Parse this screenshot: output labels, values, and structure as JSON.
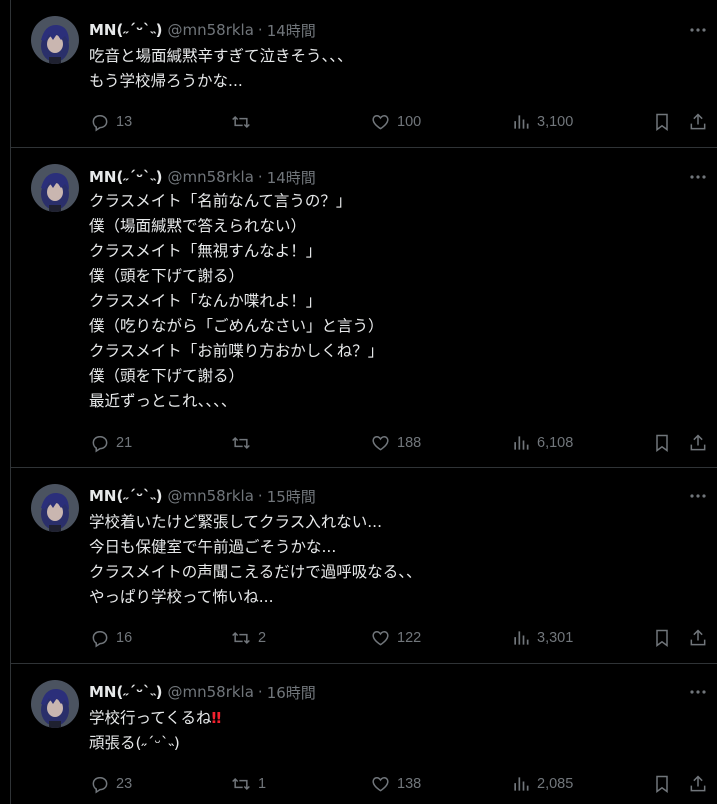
{
  "colors": {
    "background": "#000000",
    "text_primary": "#e7e9ea",
    "text_secondary": "#71767b",
    "divider": "#2f3336",
    "emoji_red": "#f4212e"
  },
  "tweets": [
    {
      "display_name": "MN(˶ˊᵕˋ˵)",
      "handle": "@mn58rkla",
      "separator": "·",
      "time": "14時間",
      "lines": [
        "吃音と場面緘黙辛すぎて泣きそう、、、",
        "もう学校帰ろうかな..."
      ],
      "replies": "13",
      "reposts": "",
      "likes": "100",
      "views": "3,100"
    },
    {
      "display_name": "MN(˶ˊᵕˋ˵)",
      "handle": "@mn58rkla",
      "separator": "·",
      "time": "14時間",
      "lines": [
        "クラスメイト「名前なんて言うの？」",
        "僕（場面緘黙で答えられない）",
        "クラスメイト「無視すんなよ！」",
        "僕（頭を下げて謝る）",
        "クラスメイト「なんか喋れよ！」",
        "僕（吃りながら「ごめんなさい」と言う）",
        "クラスメイト「お前喋り方おかしくね？」",
        "僕（頭を下げて謝る）",
        "最近ずっとこれ、、、、"
      ],
      "replies": "21",
      "reposts": "",
      "likes": "188",
      "views": "6,108"
    },
    {
      "display_name": "MN(˶ˊᵕˋ˵)",
      "handle": "@mn58rkla",
      "separator": "·",
      "time": "15時間",
      "lines": [
        "学校着いたけど緊張してクラス入れない...",
        "今日も保健室で午前過ごそうかな...",
        "クラスメイトの声聞こえるだけで過呼吸なる、、",
        "やっぱり学校って怖いね..."
      ],
      "replies": "16",
      "reposts": "2",
      "likes": "122",
      "views": "3,301"
    },
    {
      "display_name": "MN(˶ˊᵕˋ˵)",
      "handle": "@mn58rkla",
      "separator": "·",
      "time": "16時間",
      "lines": [
        "学校行ってくるね",
        "頑張る(˶ˊᵕˋ˵)"
      ],
      "emoji_after_first_line": "‼",
      "replies": "23",
      "reposts": "1",
      "likes": "138",
      "views": "2,085"
    }
  ]
}
